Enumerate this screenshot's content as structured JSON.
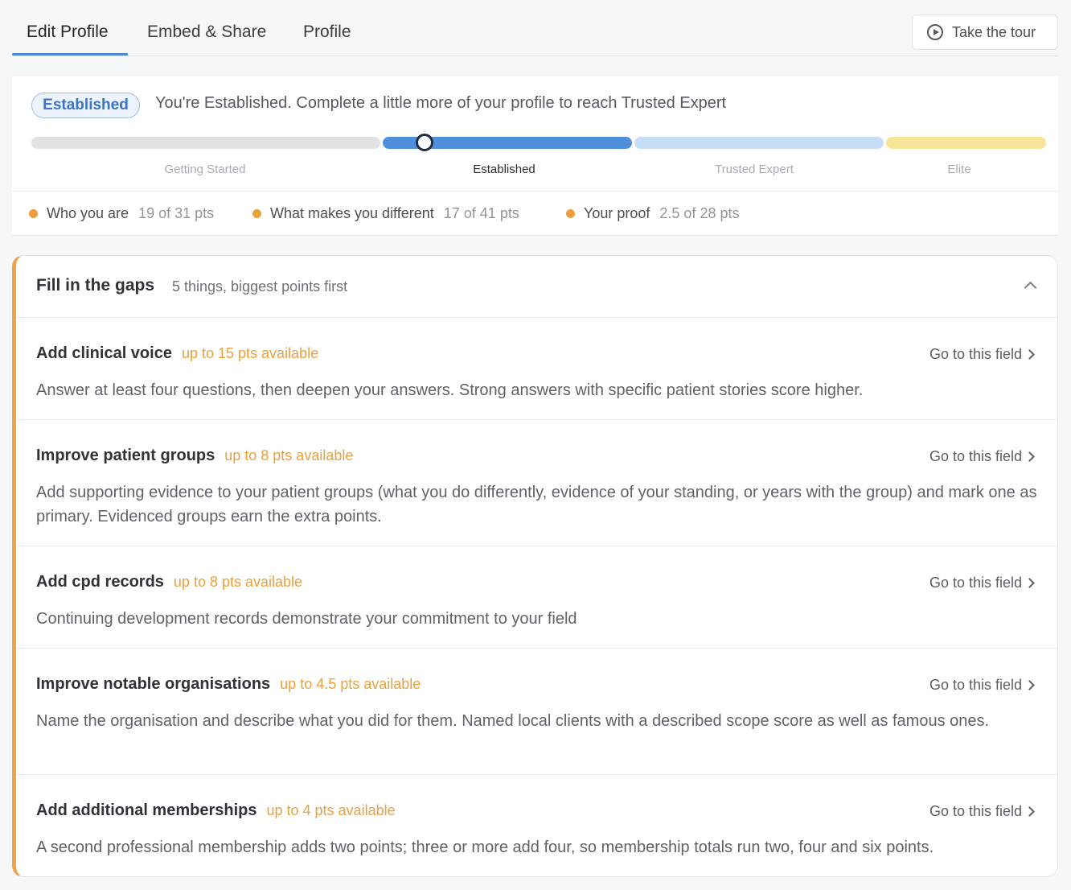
{
  "tabs": [
    {
      "label": "Edit Profile",
      "active": true
    },
    {
      "label": "Embed & Share",
      "active": false
    },
    {
      "label": "Profile",
      "active": false
    }
  ],
  "tour_button": {
    "label": "Take the tour",
    "icon": "play-circle-icon"
  },
  "level": {
    "badge": "Established",
    "message": "You're Established. Complete a little more of your profile to reach Trusted Expert",
    "stages": [
      {
        "label": "Getting Started",
        "color": "#e2e2e4"
      },
      {
        "label": "Established",
        "color": "#4f8fdb"
      },
      {
        "label": "Trusted Expert",
        "color": "#c8def6"
      },
      {
        "label": "Elite",
        "color": "#f7e69a"
      }
    ],
    "current_stage": "Established"
  },
  "categories": [
    {
      "name": "Who you are",
      "pts": "19 of 31 pts"
    },
    {
      "name": "What makes you different",
      "pts": "17 of 41 pts"
    },
    {
      "name": "Your proof",
      "pts": "2.5 of 28 pts"
    }
  ],
  "accent_color": "#eba03c",
  "gaps": {
    "title": "Fill in the gaps",
    "subtitle": "5 things, biggest points first",
    "link_label": "Go to this field",
    "items": [
      {
        "title": "Add clinical voice",
        "pts": "up to 15 pts available",
        "desc": "Answer at least four questions, then deepen your answers. Strong answers with specific patient stories score higher."
      },
      {
        "title": "Improve patient groups",
        "pts": "up to 8 pts available",
        "desc": "Add supporting evidence to your patient groups (what you do differently, evidence of your standing, or years with the group) and mark one as primary. Evidenced groups earn the extra points."
      },
      {
        "title": "Add cpd records",
        "pts": "up to 8 pts available",
        "desc": "Continuing development records demonstrate your commitment to your field"
      },
      {
        "title": "Improve notable organisations",
        "pts": "up to 4.5 pts available",
        "desc": "Name the organisation and describe what you did for them. Named local clients with a described scope score as well as famous ones."
      },
      {
        "title": "Add additional memberships",
        "pts": "up to 4 pts available",
        "desc": "A second professional membership adds two points; three or more add four, so membership totals run two, four and six points."
      }
    ]
  }
}
